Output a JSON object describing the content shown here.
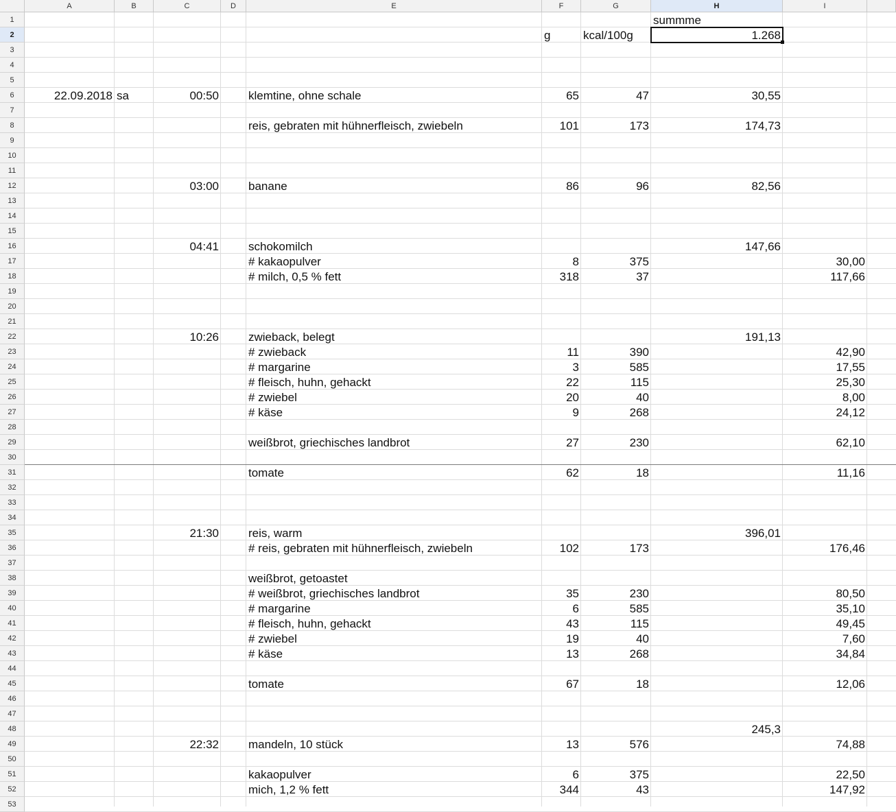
{
  "columns": [
    "A",
    "B",
    "C",
    "D",
    "E",
    "F",
    "G",
    "H",
    "I"
  ],
  "selected_column": "H",
  "selected_row": 2,
  "row_count": 53,
  "cells": [
    {
      "row": 1,
      "col": "H",
      "text": "summme",
      "align": "l"
    },
    {
      "row": 2,
      "col": "F",
      "text": "g",
      "align": "l"
    },
    {
      "row": 2,
      "col": "G",
      "text": "kcal/100g",
      "align": "l"
    },
    {
      "row": 2,
      "col": "H",
      "text": "1.268",
      "align": "r"
    },
    {
      "row": 6,
      "col": "A",
      "text": "22.09.2018",
      "align": "r"
    },
    {
      "row": 6,
      "col": "B",
      "text": "sa",
      "align": "l"
    },
    {
      "row": 6,
      "col": "C",
      "text": "00:50",
      "align": "r"
    },
    {
      "row": 6,
      "col": "E",
      "text": "klemtine, ohne schale",
      "align": "l"
    },
    {
      "row": 6,
      "col": "F",
      "text": "65",
      "align": "r"
    },
    {
      "row": 6,
      "col": "G",
      "text": "47",
      "align": "r"
    },
    {
      "row": 6,
      "col": "H",
      "text": "30,55",
      "align": "r"
    },
    {
      "row": 8,
      "col": "E",
      "text": "reis, gebraten mit hühnerfleisch, zwiebeln",
      "align": "l"
    },
    {
      "row": 8,
      "col": "F",
      "text": "101",
      "align": "r"
    },
    {
      "row": 8,
      "col": "G",
      "text": "173",
      "align": "r"
    },
    {
      "row": 8,
      "col": "H",
      "text": "174,73",
      "align": "r"
    },
    {
      "row": 12,
      "col": "C",
      "text": "03:00",
      "align": "r"
    },
    {
      "row": 12,
      "col": "E",
      "text": "banane",
      "align": "l"
    },
    {
      "row": 12,
      "col": "F",
      "text": "86",
      "align": "r"
    },
    {
      "row": 12,
      "col": "G",
      "text": "96",
      "align": "r"
    },
    {
      "row": 12,
      "col": "H",
      "text": "82,56",
      "align": "r"
    },
    {
      "row": 16,
      "col": "C",
      "text": "04:41",
      "align": "r"
    },
    {
      "row": 16,
      "col": "E",
      "text": "schokomilch",
      "align": "l"
    },
    {
      "row": 16,
      "col": "H",
      "text": "147,66",
      "align": "r"
    },
    {
      "row": 17,
      "col": "E",
      "text": "# kakaopulver",
      "align": "l"
    },
    {
      "row": 17,
      "col": "F",
      "text": "8",
      "align": "r"
    },
    {
      "row": 17,
      "col": "G",
      "text": "375",
      "align": "r"
    },
    {
      "row": 17,
      "col": "I",
      "text": "30,00",
      "align": "r"
    },
    {
      "row": 18,
      "col": "E",
      "text": "#  milch, 0,5 % fett",
      "align": "l"
    },
    {
      "row": 18,
      "col": "F",
      "text": "318",
      "align": "r"
    },
    {
      "row": 18,
      "col": "G",
      "text": "37",
      "align": "r"
    },
    {
      "row": 18,
      "col": "I",
      "text": "117,66",
      "align": "r"
    },
    {
      "row": 22,
      "col": "C",
      "text": "10:26",
      "align": "r"
    },
    {
      "row": 22,
      "col": "E",
      "text": "zwieback, belegt",
      "align": "l"
    },
    {
      "row": 22,
      "col": "H",
      "text": "191,13",
      "align": "r"
    },
    {
      "row": 23,
      "col": "E",
      "text": "# zwieback",
      "align": "l"
    },
    {
      "row": 23,
      "col": "F",
      "text": "11",
      "align": "r"
    },
    {
      "row": 23,
      "col": "G",
      "text": "390",
      "align": "r"
    },
    {
      "row": 23,
      "col": "I",
      "text": "42,90",
      "align": "r"
    },
    {
      "row": 24,
      "col": "E",
      "text": "# margarine",
      "align": "l"
    },
    {
      "row": 24,
      "col": "F",
      "text": "3",
      "align": "r"
    },
    {
      "row": 24,
      "col": "G",
      "text": "585",
      "align": "r"
    },
    {
      "row": 24,
      "col": "I",
      "text": "17,55",
      "align": "r"
    },
    {
      "row": 25,
      "col": "E",
      "text": "# fleisch, huhn, gehackt",
      "align": "l"
    },
    {
      "row": 25,
      "col": "F",
      "text": "22",
      "align": "r"
    },
    {
      "row": 25,
      "col": "G",
      "text": "115",
      "align": "r"
    },
    {
      "row": 25,
      "col": "I",
      "text": "25,30",
      "align": "r"
    },
    {
      "row": 26,
      "col": "E",
      "text": "# zwiebel",
      "align": "l"
    },
    {
      "row": 26,
      "col": "F",
      "text": "20",
      "align": "r"
    },
    {
      "row": 26,
      "col": "G",
      "text": "40",
      "align": "r"
    },
    {
      "row": 26,
      "col": "I",
      "text": "8,00",
      "align": "r"
    },
    {
      "row": 27,
      "col": "E",
      "text": "# käse",
      "align": "l"
    },
    {
      "row": 27,
      "col": "F",
      "text": "9",
      "align": "r"
    },
    {
      "row": 27,
      "col": "G",
      "text": "268",
      "align": "r"
    },
    {
      "row": 27,
      "col": "I",
      "text": "24,12",
      "align": "r"
    },
    {
      "row": 29,
      "col": "E",
      "text": "weißbrot, griechisches landbrot",
      "align": "l"
    },
    {
      "row": 29,
      "col": "F",
      "text": "27",
      "align": "r"
    },
    {
      "row": 29,
      "col": "G",
      "text": "230",
      "align": "r"
    },
    {
      "row": 29,
      "col": "I",
      "text": "62,10",
      "align": "r"
    },
    {
      "row": 31,
      "col": "E",
      "text": "tomate",
      "align": "l"
    },
    {
      "row": 31,
      "col": "F",
      "text": "62",
      "align": "r"
    },
    {
      "row": 31,
      "col": "G",
      "text": "18",
      "align": "r"
    },
    {
      "row": 31,
      "col": "I",
      "text": "11,16",
      "align": "r"
    },
    {
      "row": 35,
      "col": "C",
      "text": "21:30",
      "align": "r"
    },
    {
      "row": 35,
      "col": "E",
      "text": "reis, warm",
      "align": "l"
    },
    {
      "row": 35,
      "col": "H",
      "text": "396,01",
      "align": "r"
    },
    {
      "row": 36,
      "col": "E",
      "text": "# reis, gebraten mit hühnerfleisch, zwiebeln",
      "align": "l"
    },
    {
      "row": 36,
      "col": "F",
      "text": "102",
      "align": "r"
    },
    {
      "row": 36,
      "col": "G",
      "text": "173",
      "align": "r"
    },
    {
      "row": 36,
      "col": "I",
      "text": "176,46",
      "align": "r"
    },
    {
      "row": 38,
      "col": "E",
      "text": "weißbrot, getoastet",
      "align": "l"
    },
    {
      "row": 39,
      "col": "E",
      "text": "# weißbrot, griechisches landbrot",
      "align": "l"
    },
    {
      "row": 39,
      "col": "F",
      "text": "35",
      "align": "r"
    },
    {
      "row": 39,
      "col": "G",
      "text": "230",
      "align": "r"
    },
    {
      "row": 39,
      "col": "I",
      "text": "80,50",
      "align": "r"
    },
    {
      "row": 40,
      "col": "E",
      "text": "# margarine",
      "align": "l"
    },
    {
      "row": 40,
      "col": "F",
      "text": "6",
      "align": "r"
    },
    {
      "row": 40,
      "col": "G",
      "text": "585",
      "align": "r"
    },
    {
      "row": 40,
      "col": "I",
      "text": "35,10",
      "align": "r"
    },
    {
      "row": 41,
      "col": "E",
      "text": "# fleisch, huhn, gehackt",
      "align": "l"
    },
    {
      "row": 41,
      "col": "F",
      "text": "43",
      "align": "r"
    },
    {
      "row": 41,
      "col": "G",
      "text": "115",
      "align": "r"
    },
    {
      "row": 41,
      "col": "I",
      "text": "49,45",
      "align": "r"
    },
    {
      "row": 42,
      "col": "E",
      "text": "# zwiebel",
      "align": "l"
    },
    {
      "row": 42,
      "col": "F",
      "text": "19",
      "align": "r"
    },
    {
      "row": 42,
      "col": "G",
      "text": "40",
      "align": "r"
    },
    {
      "row": 42,
      "col": "I",
      "text": "7,60",
      "align": "r"
    },
    {
      "row": 43,
      "col": "E",
      "text": "# käse",
      "align": "l"
    },
    {
      "row": 43,
      "col": "F",
      "text": "13",
      "align": "r"
    },
    {
      "row": 43,
      "col": "G",
      "text": "268",
      "align": "r"
    },
    {
      "row": 43,
      "col": "I",
      "text": "34,84",
      "align": "r"
    },
    {
      "row": 45,
      "col": "E",
      "text": "tomate",
      "align": "l"
    },
    {
      "row": 45,
      "col": "F",
      "text": "67",
      "align": "r"
    },
    {
      "row": 45,
      "col": "G",
      "text": "18",
      "align": "r"
    },
    {
      "row": 45,
      "col": "I",
      "text": "12,06",
      "align": "r"
    },
    {
      "row": 48,
      "col": "H",
      "text": "245,3",
      "align": "r"
    },
    {
      "row": 49,
      "col": "C",
      "text": "22:32",
      "align": "r"
    },
    {
      "row": 49,
      "col": "E",
      "text": "mandeln, 10 stück",
      "align": "l"
    },
    {
      "row": 49,
      "col": "F",
      "text": "13",
      "align": "r"
    },
    {
      "row": 49,
      "col": "G",
      "text": "576",
      "align": "r"
    },
    {
      "row": 49,
      "col": "I",
      "text": "74,88",
      "align": "r"
    },
    {
      "row": 51,
      "col": "E",
      "text": "kakaopulver",
      "align": "l"
    },
    {
      "row": 51,
      "col": "F",
      "text": "6",
      "align": "r"
    },
    {
      "row": 51,
      "col": "G",
      "text": "375",
      "align": "r"
    },
    {
      "row": 51,
      "col": "I",
      "text": "22,50",
      "align": "r"
    },
    {
      "row": 52,
      "col": "E",
      "text": "mich, 1,2 % fett",
      "align": "l"
    },
    {
      "row": 52,
      "col": "F",
      "text": "344",
      "align": "r"
    },
    {
      "row": 52,
      "col": "G",
      "text": "43",
      "align": "r"
    },
    {
      "row": 52,
      "col": "I",
      "text": "147,92",
      "align": "r"
    }
  ]
}
